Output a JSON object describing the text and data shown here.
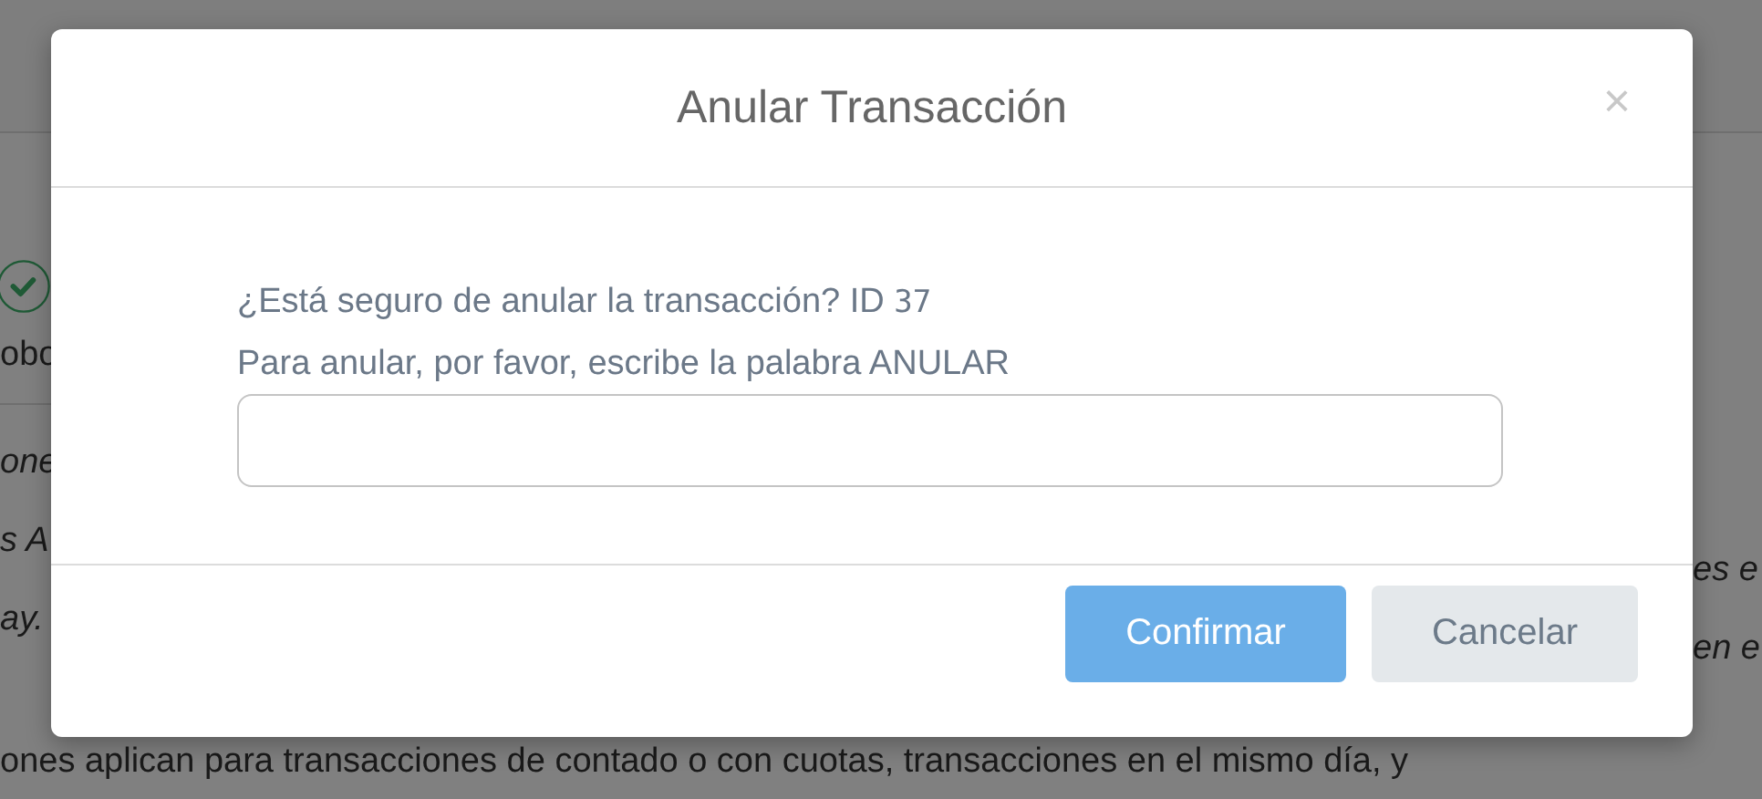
{
  "background": {
    "left_fragments": [
      "obo",
      "one",
      "s A",
      "ay."
    ],
    "right_fragments": [
      "es e",
      "en e"
    ],
    "bottom_line": "ones aplican para transacciones de contado o con cuotas, transacciones en el mismo día, y"
  },
  "dialog": {
    "title": "Anular Transacción",
    "close": "×",
    "question": "¿Está seguro de anular la transacción? ID",
    "id": "37",
    "instruction": "Para anular, por favor, escribe la palabra ANULAR",
    "buttons": [
      {
        "label": "Confirmar",
        "kind": "primary"
      },
      {
        "label": "Cancelar",
        "kind": "secondary"
      }
    ]
  }
}
